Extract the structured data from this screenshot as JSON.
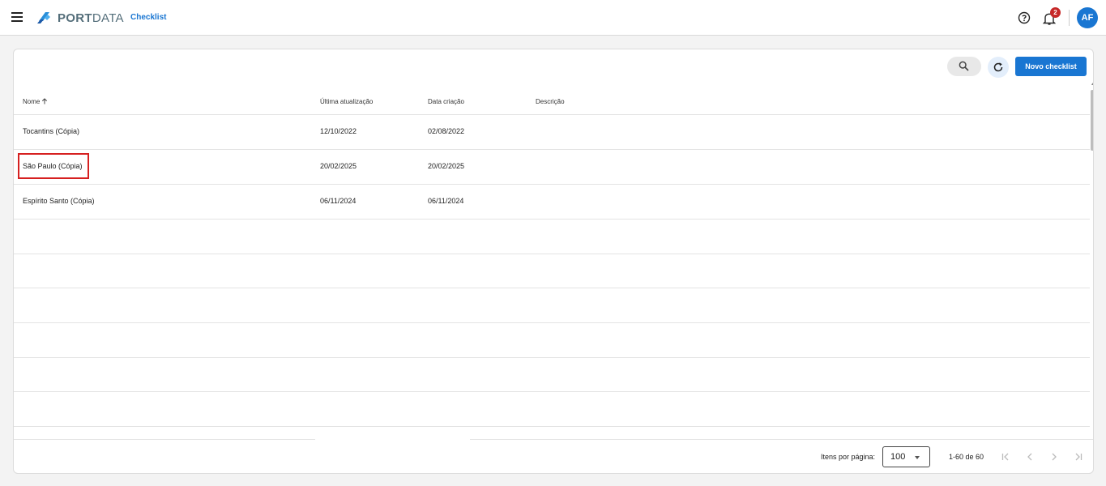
{
  "header": {
    "brand_bold": "PORT",
    "brand_light": "DATA",
    "app_title": "Checklist",
    "notification_count": "2",
    "user_initials": "AF"
  },
  "toolbar": {
    "new_button_label": "Novo checklist"
  },
  "table": {
    "columns": {
      "nome": "Nome",
      "ultima": "Última atualização",
      "data": "Data criação",
      "descricao": "Descrição"
    },
    "rows": [
      {
        "nome": "Tocantins (Cópia)",
        "ultima": "12/10/2022",
        "data": "02/08/2022",
        "descricao": ""
      },
      {
        "nome": "São Paulo (Cópia)",
        "ultima": "20/02/2025",
        "data": "20/02/2025",
        "descricao": ""
      },
      {
        "nome": "Espírito Santo (Cópia)",
        "ultima": "06/11/2024",
        "data": "06/11/2024",
        "descricao": ""
      }
    ]
  },
  "pagination": {
    "items_per_page_label": "Itens por página:",
    "items_per_page_value": "100",
    "range_label": "1-60 de 60"
  },
  "colors": {
    "accent": "#1976d2",
    "badge": "#c62828",
    "highlight": "#d62020"
  }
}
